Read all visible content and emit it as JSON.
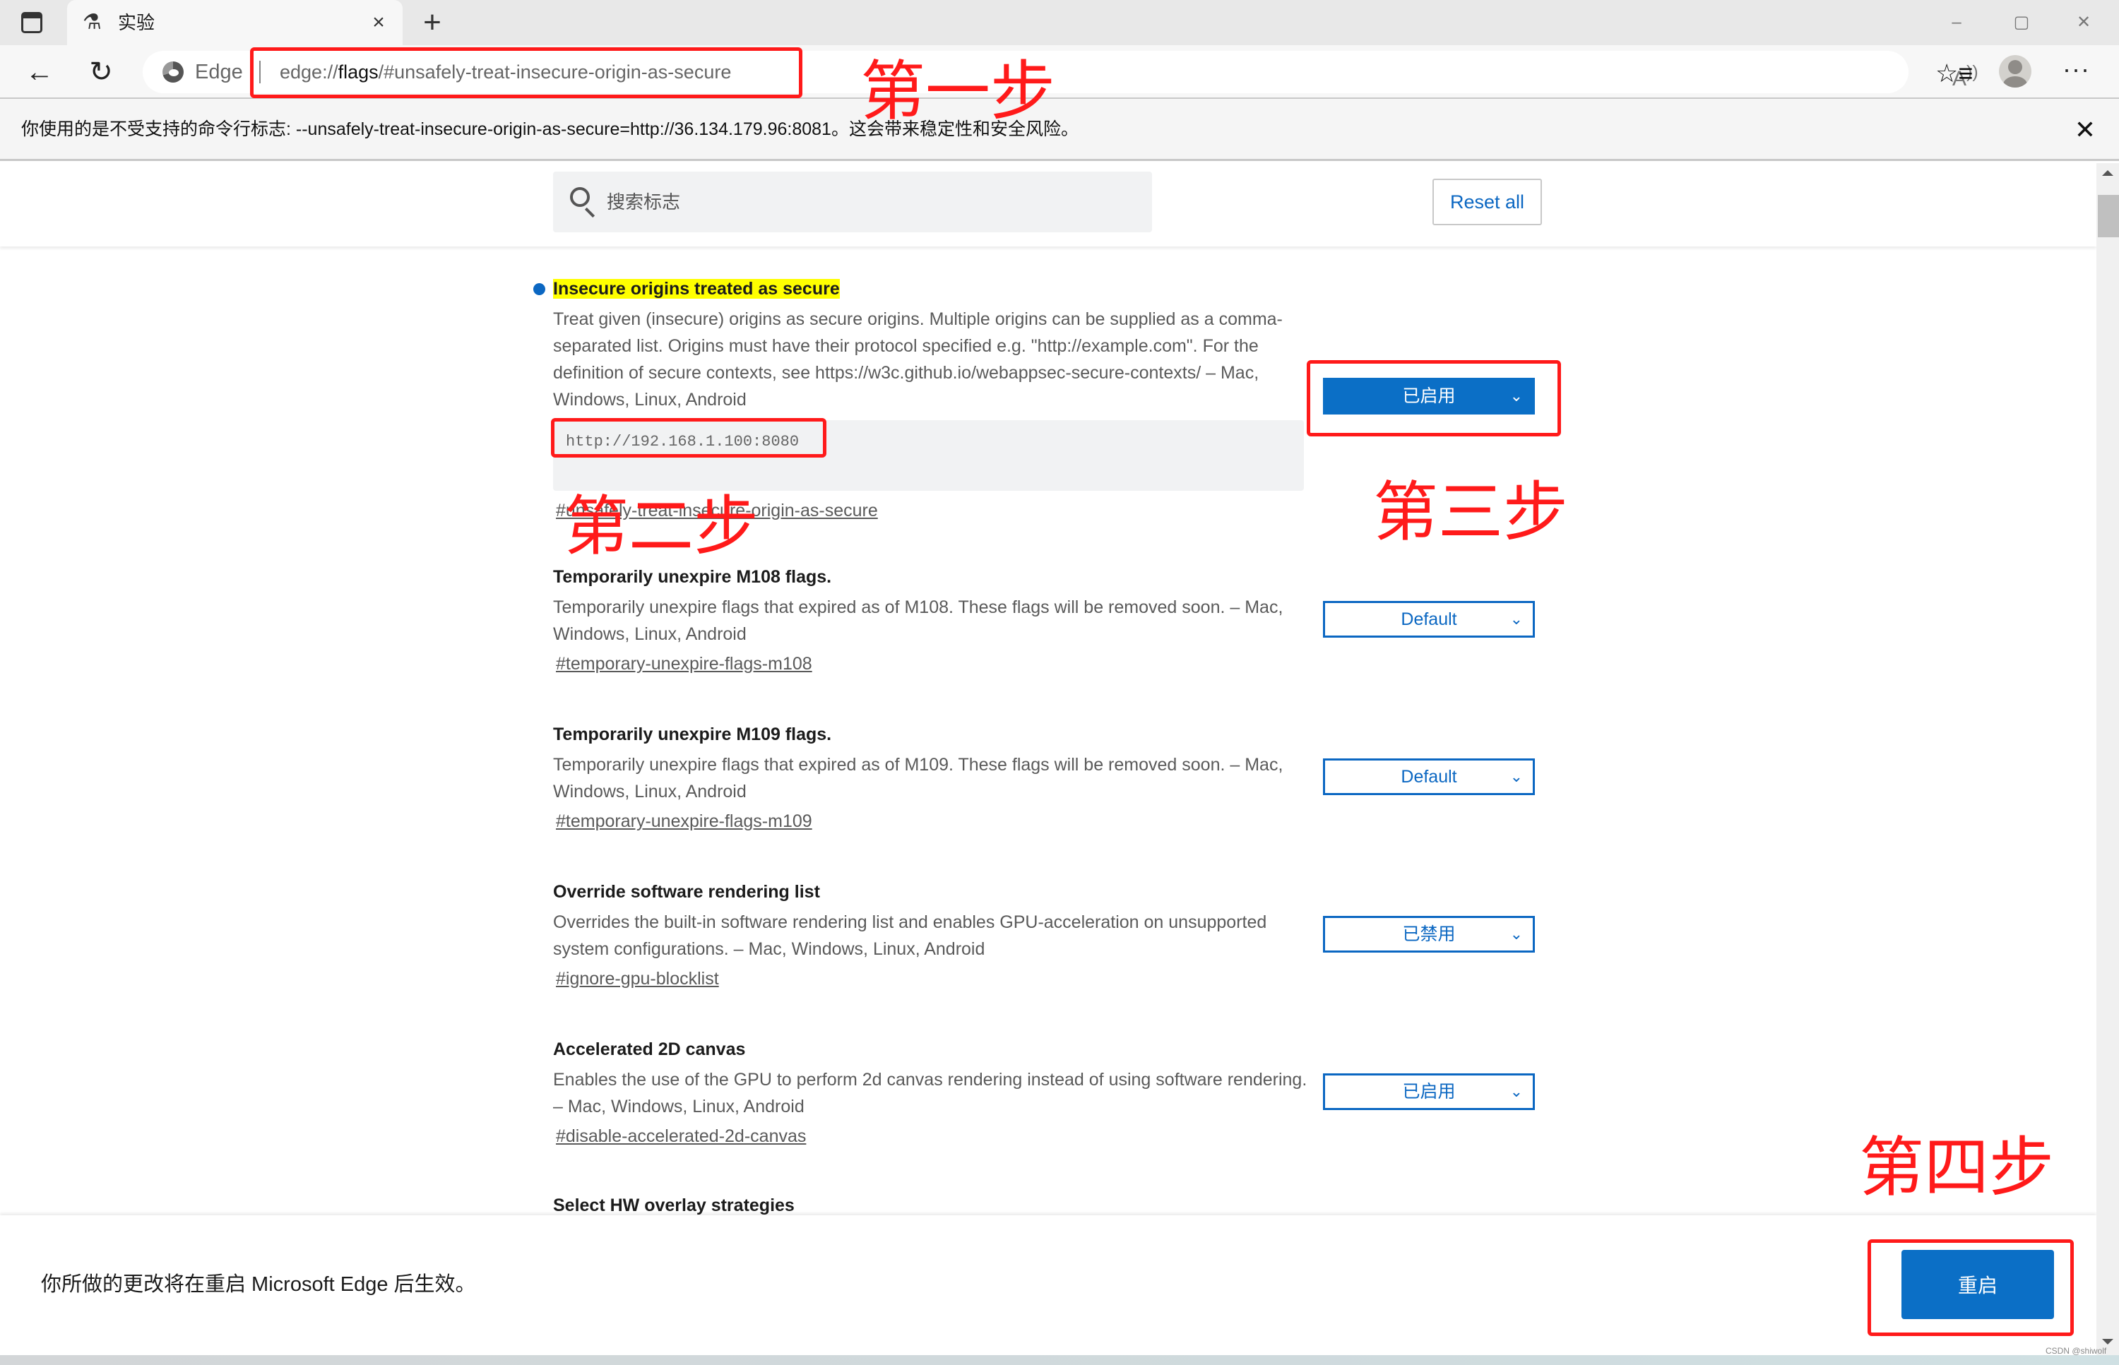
{
  "browser": {
    "tab": {
      "title": "实验",
      "icon": "flask-icon"
    },
    "new_tab_label": "+",
    "window_controls": {
      "minimize": "–",
      "maximize": "▢",
      "close": "✕"
    },
    "omnibox": {
      "site_label": "Edge",
      "url_prefix": "edge://",
      "url_host": "flags",
      "url_rest": "/#unsafely-treat-insecure-origin-as-secure"
    },
    "toolbar_icons": [
      "back-arrow-icon",
      "refresh-icon",
      "read-aloud-icon",
      "add-favorite-icon",
      "favorites-icon",
      "profile-icon",
      "more-icon"
    ]
  },
  "infobar": {
    "text": "你使用的是不受支持的命令行标志: --unsafely-treat-insecure-origin-as-secure=http://36.134.179.96:8081。这会带来稳定性和安全风险。",
    "close": "✕"
  },
  "header": {
    "search_placeholder": "搜索标志",
    "reset_label": "Reset all"
  },
  "flags": [
    {
      "title": "Insecure origins treated as secure",
      "description": "Treat given (insecure) origins as secure origins. Multiple origins can be supplied as a comma-separated list. Origins must have their protocol specified e.g. \"http://example.com\". For the definition of secure contexts, see https://w3c.github.io/webappsec-secure-contexts/ – Mac, Windows, Linux, Android",
      "textarea_value": "http://192.168.1.100:8080",
      "link": "#unsafely-treat-insecure-origin-as-secure",
      "state": "已启用",
      "modified": true
    },
    {
      "title": "Temporarily unexpire M108 flags.",
      "description": "Temporarily unexpire flags that expired as of M108. These flags will be removed soon. – Mac, Windows, Linux, Android",
      "link": "#temporary-unexpire-flags-m108",
      "state": "Default"
    },
    {
      "title": "Temporarily unexpire M109 flags.",
      "description": "Temporarily unexpire flags that expired as of M109. These flags will be removed soon. – Mac, Windows, Linux, Android",
      "link": "#temporary-unexpire-flags-m109",
      "state": "Default"
    },
    {
      "title": "Override software rendering list",
      "description": "Overrides the built-in software rendering list and enables GPU-acceleration on unsupported system configurations. – Mac, Windows, Linux, Android",
      "link": "#ignore-gpu-blocklist",
      "state": "已禁用"
    },
    {
      "title": "Accelerated 2D canvas",
      "description": "Enables the use of the GPU to perform 2d canvas rendering instead of using software rendering. – Mac, Windows, Linux, Android",
      "link": "#disable-accelerated-2d-canvas",
      "state": "已启用"
    },
    {
      "title": "Select HW overlay strategies"
    }
  ],
  "annotations": {
    "step1": "第一步",
    "step2": "第二步",
    "step3": "第三步",
    "step4": "第四步",
    "color": "#ff1a1a"
  },
  "restart_bar": {
    "message": "你所做的更改将在重启 Microsoft Edge 后生效。",
    "button_label": "重启"
  },
  "watermark": "CSDN @shiwolf",
  "colors": {
    "accent": "#0b6fc6",
    "highlight": "#ffff00",
    "annotation": "#ff1a1a"
  }
}
